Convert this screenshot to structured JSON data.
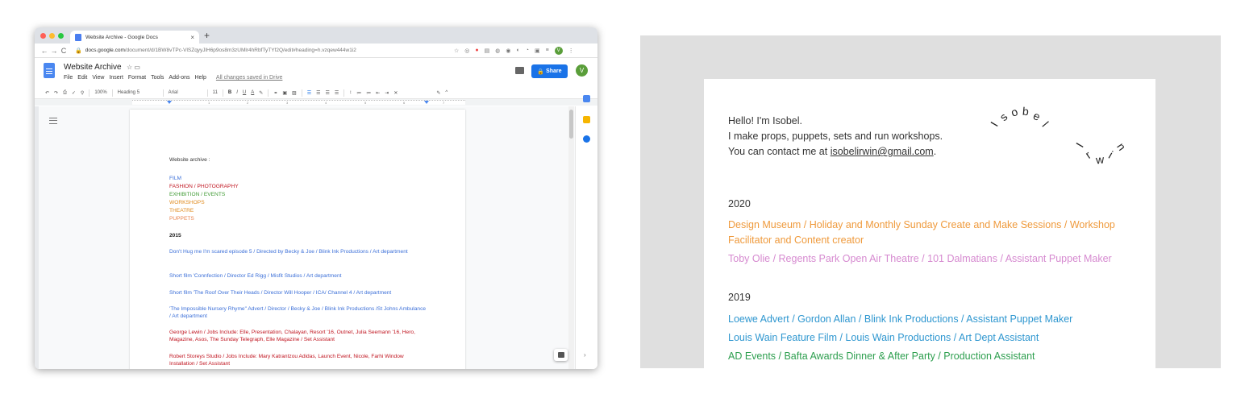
{
  "browser": {
    "tab_title": "Website Archive - Google Docs",
    "tab_close": "×",
    "new_tab": "+",
    "url_host": "docs.google.com",
    "url_path": "/document/d/1BW8vTPc-VlSZqyyJlH6p9os8m3zUMlr4hRbfTyTYf2Q/edit#heading=h.vzqew444w1i2",
    "nav": {
      "back": "←",
      "forward": "→",
      "reload": "C"
    },
    "user_initial": "V"
  },
  "docs": {
    "title": "Website Archive",
    "menu": [
      "File",
      "Edit",
      "View",
      "Insert",
      "Format",
      "Tools",
      "Add-ons",
      "Help"
    ],
    "saved_status": "All changes saved in Drive",
    "share_label": "Share",
    "user_initial": "V",
    "toolbar": {
      "zoom": "100%",
      "style": "Heading 5",
      "font": "Arial",
      "size": "11",
      "bold": "B",
      "italic": "I",
      "underline": "U",
      "text_color": "A"
    },
    "ruler_numbers": [
      "1",
      "1",
      "2",
      "3",
      "4",
      "5",
      "6",
      "7"
    ],
    "content": [
      {
        "text": "Website archive :",
        "color": "#333333"
      },
      {
        "text": "FILM",
        "color": "#3b6fd8"
      },
      {
        "text": "FASHION / PHOTOGRAPHY",
        "color": "#c0141f"
      },
      {
        "text": "EXHIBITION / EVENTS",
        "color": "#3f9a33"
      },
      {
        "text": "WORKSHOPS",
        "color": "#e08b1e"
      },
      {
        "text": "THEATRE",
        "color": "#e08b1e"
      },
      {
        "text": "PUPPETS",
        "color": "#e8844e"
      },
      {
        "text": "2015",
        "color": "#222222"
      },
      {
        "text": "Don't Hug me I'm scared episode 5 / Directed by Becky & Joe / Blink Ink Productions / Art department",
        "color": "#3b6fd8"
      },
      {
        "text": "Short film 'Connfection / Director Ed Rigg / Misfit Studios / Art department",
        "color": "#3b6fd8"
      },
      {
        "text": "Short film 'The Roof Over Their Heads / Director Will Hooper / ICA/ Channel 4 / Art department",
        "color": "#3b6fd8"
      },
      {
        "text": "'The Impossible Nursery Rhyme\"  Advert /  Director / Becky & Joe / Blink Ink Productions /St Johns Ambulance / Art department",
        "color": "#3b6fd8"
      },
      {
        "text": "George Lewin / Jobs Include: Elle, Presentation, Chalayan, Resort '16, Outnet, Julia Seemann '16, Hero, Magazine, Asos, The Sunday Telegraph, Elle Magazine / Set Assistant",
        "color": "#c0141f"
      },
      {
        "text": "Robert Storeys Studio / Jobs Include: Mary Katrantzou Adidas, Launch Event, Nicole, Farhi Window Installation / Set Assistant",
        "color": "#c0141f"
      }
    ]
  },
  "site": {
    "intro": [
      "Hello! I'm Isobel.",
      "I make props, puppets, sets and run workshops."
    ],
    "contact_prefix": "You can contact me at ",
    "contact_email": "isobelirwin@gmail.com",
    "contact_suffix": ".",
    "logo_letters": [
      "I",
      "s",
      "o",
      "b",
      "e",
      "l",
      "I",
      "r",
      "w",
      "i",
      "n"
    ],
    "years": [
      {
        "year": "2020",
        "entries": [
          {
            "text": "Design Museum / Holiday and Monthly Sunday Create and Make Sessions / Workshop Facilitator and Content creator",
            "color": "#ef9a3c"
          },
          {
            "text": "Toby Olie / Regents Park Open Air Theatre / 101 Dalmatians / Assistant Puppet Maker",
            "color": "#d68ad0"
          }
        ]
      },
      {
        "year": "2019",
        "entries": [
          {
            "text": "Loewe Advert / Gordon Allan / Blink Ink Productions / Assistant Puppet Maker",
            "color": "#2f97d0"
          },
          {
            "text": "Louis Wain Feature Film / Louis Wain Productions / Art Dept Assistant",
            "color": "#2f97d0"
          },
          {
            "text": "AD Events / Bafta Awards Dinner & After Party / Production Assistant",
            "color": "#2e9f4f"
          }
        ]
      }
    ]
  }
}
